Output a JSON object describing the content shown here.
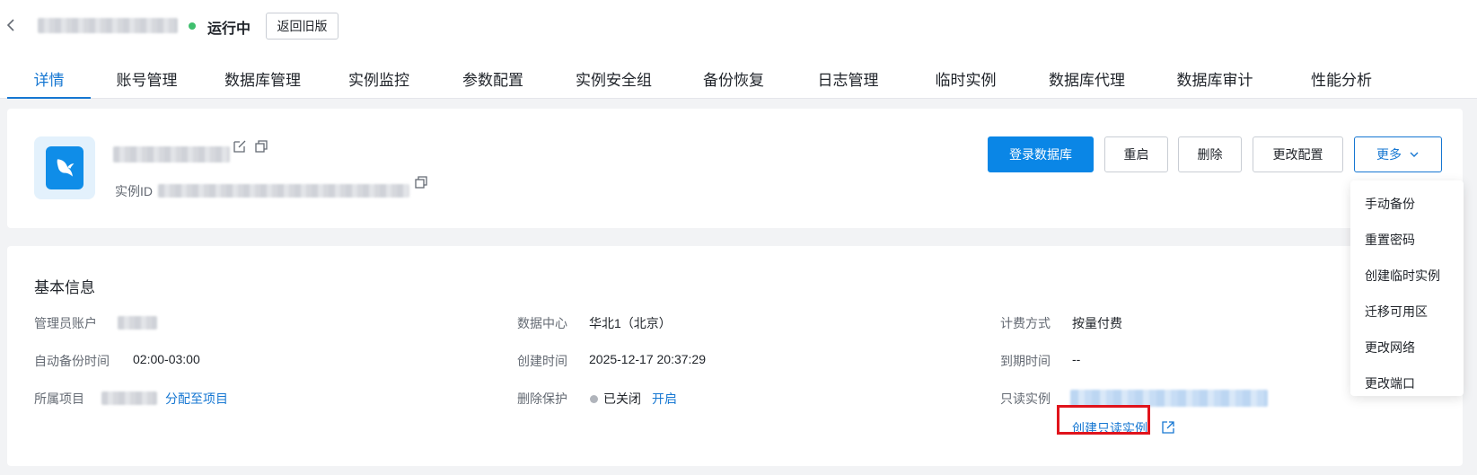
{
  "header": {
    "status": "运行中",
    "old_version_button": "返回旧版",
    "status_color": "#3fbf6e"
  },
  "tabs": [
    {
      "label": "详情",
      "active": true
    },
    {
      "label": "账号管理"
    },
    {
      "label": "数据库管理"
    },
    {
      "label": "实例监控"
    },
    {
      "label": "参数配置"
    },
    {
      "label": "实例安全组"
    },
    {
      "label": "备份恢复"
    },
    {
      "label": "日志管理"
    },
    {
      "label": "临时实例"
    },
    {
      "label": "数据库代理"
    },
    {
      "label": "数据库审计"
    },
    {
      "label": "性能分析"
    }
  ],
  "instance": {
    "id_label": "实例ID",
    "icons": [
      "mysql-dolphin-icon",
      "edit-icon",
      "copy-icon"
    ]
  },
  "actions": {
    "login": "登录数据库",
    "restart": "重启",
    "delete": "删除",
    "change_config": "更改配置",
    "more": "更多"
  },
  "more_menu": [
    "手动备份",
    "重置密码",
    "创建临时实例",
    "迁移可用区",
    "更改网络",
    "更改端口"
  ],
  "basic_info": {
    "title": "基本信息",
    "admin_account_label": "管理员账户",
    "auto_backup_label": "自动备份时间",
    "auto_backup_value": "02:00-03:00",
    "project_label": "所属项目",
    "assign_project_link": "分配至项目",
    "datacenter_label": "数据中心",
    "datacenter_value": "华北1（北京）",
    "created_label": "创建时间",
    "created_value": "2025-12-17 20:37:29",
    "delete_protect_label": "删除保护",
    "delete_protect_value": "已关闭",
    "delete_protect_link": "开启",
    "billing_label": "计费方式",
    "billing_value": "按量付费",
    "expire_label": "到期时间",
    "expire_value": "--",
    "readonly_label": "只读实例",
    "create_readonly_link": "创建只读实例"
  },
  "colors": {
    "primary": "#0a86e6",
    "link": "#1677d2",
    "highlight": "#e0141c"
  }
}
